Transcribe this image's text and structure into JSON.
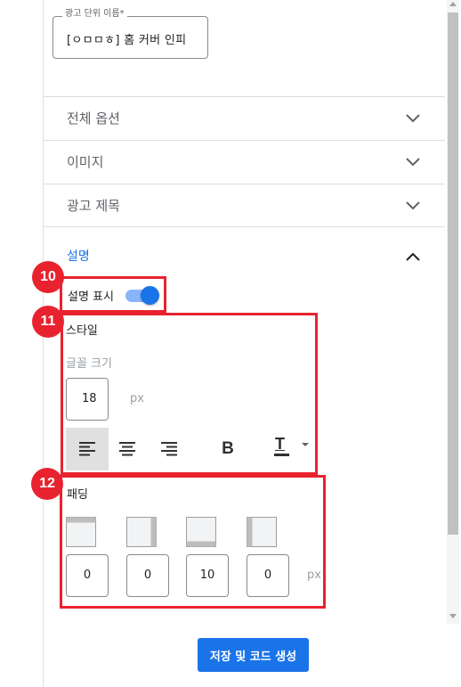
{
  "ad_name": {
    "label": "광고 단위 이름*",
    "value": "[ㅇㅁㅁㅎ] 홈 커버 인피"
  },
  "sections": [
    {
      "label": "전체 옵션",
      "expanded": false
    },
    {
      "label": "이미지",
      "expanded": false
    },
    {
      "label": "광고 제목",
      "expanded": false
    }
  ],
  "description": {
    "label": "설명",
    "expanded": true,
    "show_label": "설명 표시",
    "show_enabled": true
  },
  "style": {
    "title": "스타일",
    "font_size_label": "글꼴 크기",
    "font_size_value": "18",
    "font_size_unit": "px",
    "alignment": [
      "align-left",
      "align-center",
      "align-right"
    ],
    "selected_alignment": "align-left",
    "bold_label": "B",
    "color_label": "T"
  },
  "padding": {
    "title": "패딩",
    "values": [
      "0",
      "0",
      "10",
      "0"
    ],
    "unit": "px"
  },
  "save_button": "저장 및 코드 생성",
  "annotations": {
    "badge_10": "10",
    "badge_11": "11",
    "badge_12": "12"
  },
  "colors": {
    "accent": "#1a73e8",
    "annotation": "#e8232f"
  }
}
